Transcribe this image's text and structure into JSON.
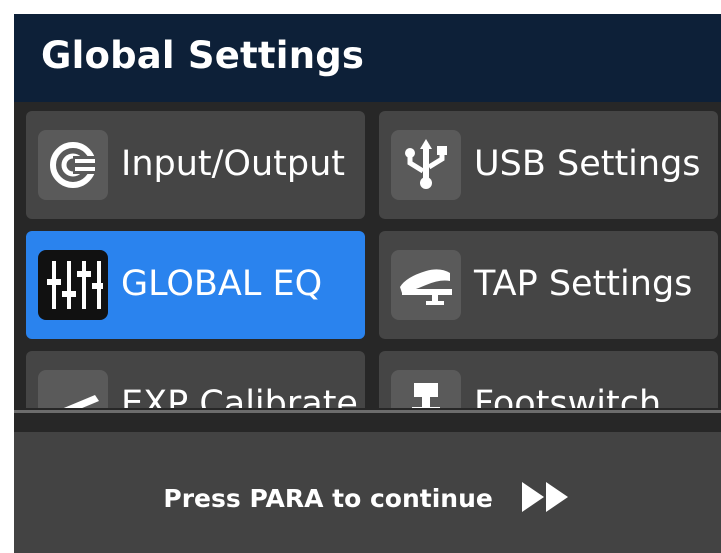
{
  "header": {
    "title": "Global Settings"
  },
  "tiles": [
    {
      "label": "Input/Output",
      "icon": "input-output-icon",
      "active": false
    },
    {
      "label": "USB Settings",
      "icon": "usb-icon",
      "active": false
    },
    {
      "label": "GLOBAL EQ",
      "icon": "equalizer-sliders-icon",
      "active": true
    },
    {
      "label": "TAP Settings",
      "icon": "tap-pedal-icon",
      "active": false
    },
    {
      "label": "EXP Calibrate",
      "icon": "expression-pedal-icon",
      "active": false
    },
    {
      "label": "Footswitch",
      "icon": "footswitch-icon",
      "active": false
    }
  ],
  "footer": {
    "prompt": "Press PARA to continue",
    "icon": "fast-forward-icon"
  },
  "colors": {
    "header_bg": "#0d2038",
    "active_tile": "#2a83ee",
    "tile_bg": "#454545",
    "footer_bg": "#434343"
  }
}
